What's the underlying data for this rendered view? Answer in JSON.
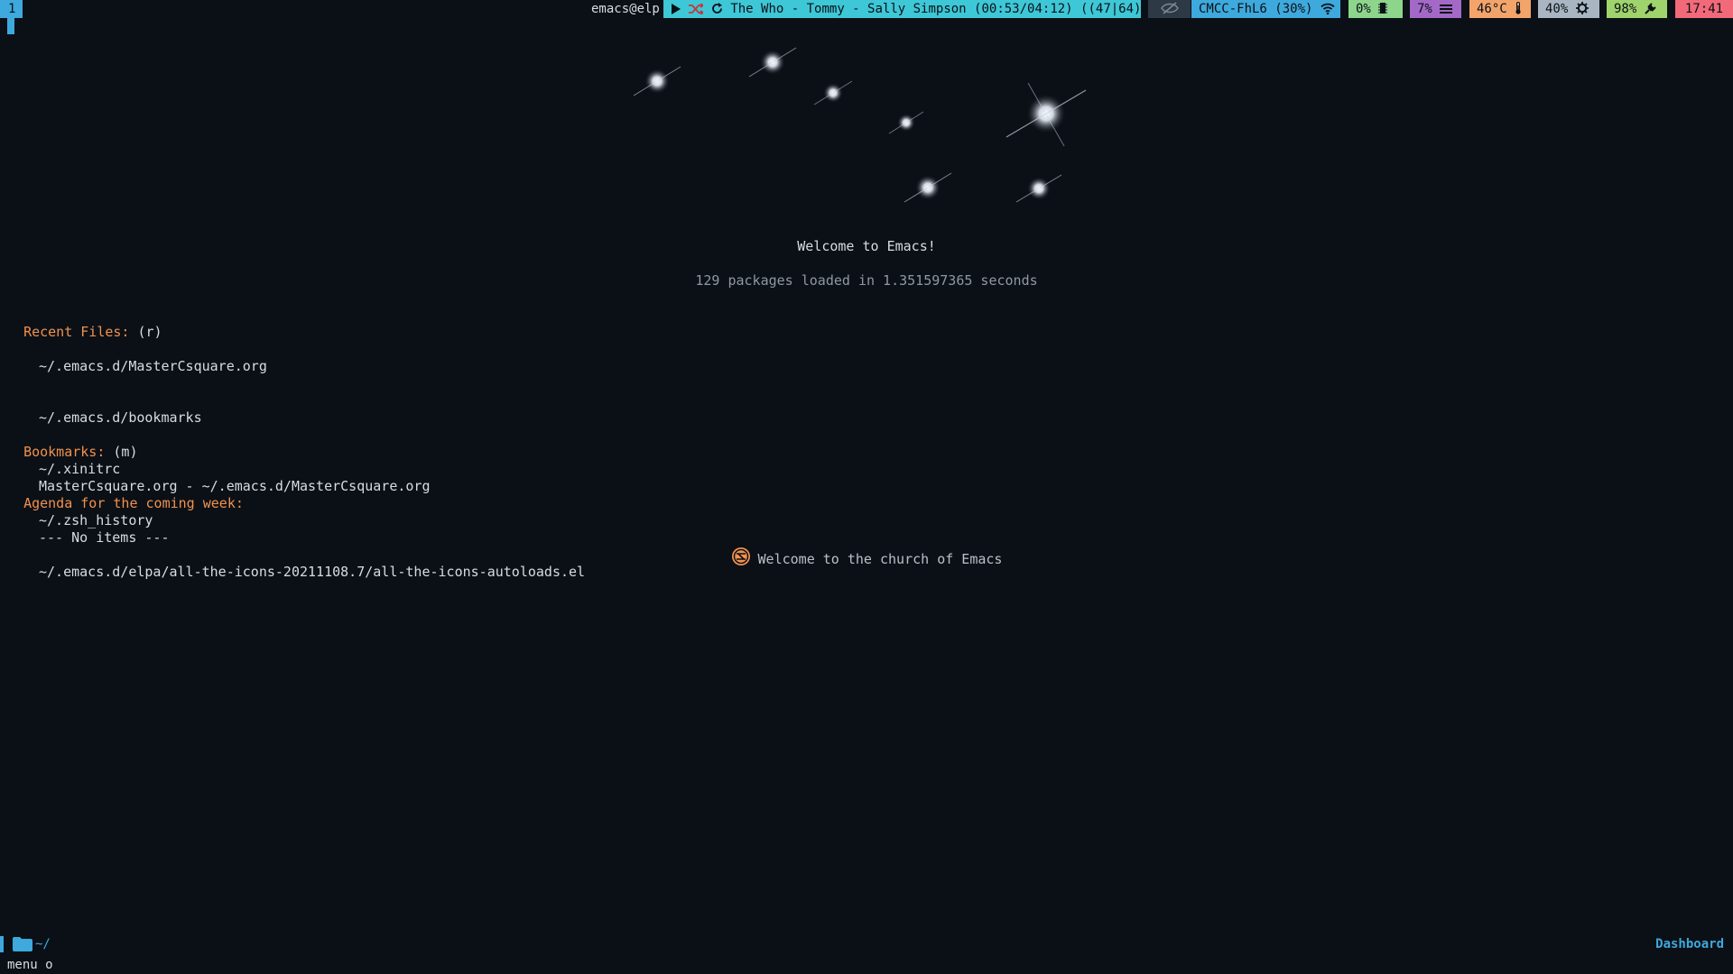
{
  "topbar": {
    "workspace": "1",
    "window_title": "emacs@elp",
    "music": {
      "track": "The Who - Tommy - Sally Simpson (00:53/04:12) ((47|64))",
      "icons": [
        "play-icon",
        "shuffle-icon",
        "repeat-icon",
        "music-note-icon"
      ]
    },
    "hidden_icon": "eye-slash-icon",
    "wifi": {
      "text": "CMCC-FhL6 (30%)",
      "icon": "wifi-icon"
    },
    "cpu": {
      "text": "0%",
      "icon": "cpu-chip-icon"
    },
    "memory": {
      "text": "7%",
      "icon": "memory-bars-icon"
    },
    "temperature": {
      "text": "46°C",
      "icon": "thermometer-icon"
    },
    "brightness": {
      "text": "40%",
      "icon": "gear-icon"
    },
    "battery": {
      "text": "98%",
      "icon": "plug-icon"
    },
    "clock": "17:41",
    "colors": {
      "music": "#3ec7d6",
      "wifi": "#3ea9dc",
      "cpu": "#8dd58b",
      "memory": "#a469c7",
      "temperature": "#f2a46b",
      "brightness": "#a9b6c1",
      "battery": "#9fd36c",
      "clock": "#f26a7a"
    }
  },
  "dashboard": {
    "welcome": "Welcome to Emacs!",
    "loaded": "129 packages loaded in 1.351597365 seconds",
    "recent_files": {
      "heading": "Recent Files:",
      "key": "(r)",
      "items": [
        "~/.emacs.d/MasterCsquare.org",
        "~/.emacs.d/bookmarks",
        "~/.xinitrc",
        "~/.zsh_history",
        "~/.emacs.d/elpa/all-the-icons-20211108.7/all-the-icons-autoloads.el"
      ]
    },
    "bookmarks": {
      "heading": "Bookmarks:",
      "key": "(m)",
      "items": [
        "MasterCsquare.org - ~/.emacs.d/MasterCsquare.org"
      ]
    },
    "agenda": {
      "heading": "Agenda for the coming week:",
      "items": [
        "--- No items ---"
      ]
    },
    "footer": "Welcome to the church of Emacs",
    "footer_icon": "emacs-emblem-icon"
  },
  "modeline": {
    "path": "~/",
    "mode": "Dashboard",
    "folder_icon": "folder-icon"
  },
  "minibuffer": "menu o",
  "accent": "#3ea9dc",
  "heading_color": "#f2914c"
}
